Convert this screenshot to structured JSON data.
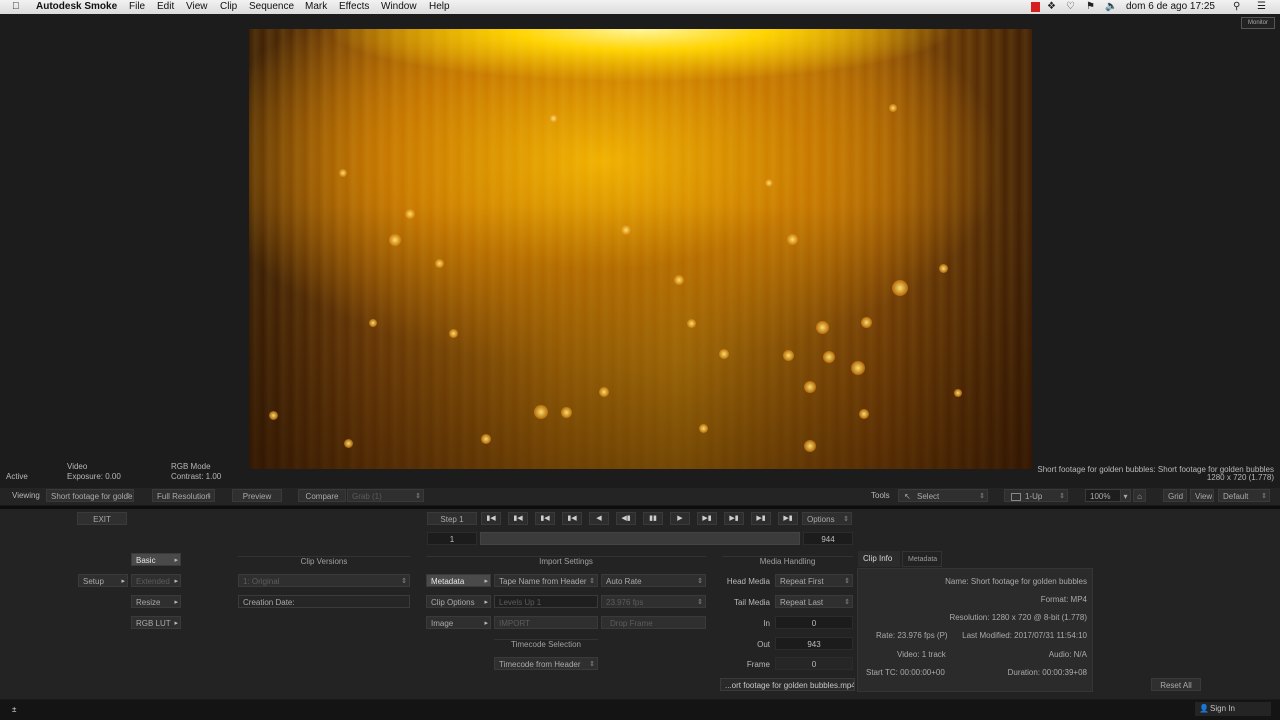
{
  "menubar": {
    "app_name": "Autodesk Smoke",
    "items": [
      "File",
      "Edit",
      "View",
      "Clip",
      "Sequence",
      "Mark",
      "Effects",
      "Window",
      "Help"
    ],
    "datetime": "dom 6 de ago  17:25"
  },
  "viewer": {
    "monitor_button": "Monitor",
    "status": "Active",
    "video_label": "Video",
    "exposure": "Exposure: 0.00",
    "rgb_mode": "RGB Mode",
    "contrast": "Contrast: 1.00",
    "clip_title": "Short footage for golden bubbles: Short footage for golden bubbles",
    "clip_res": "1280 x 720 (1.778)"
  },
  "toolbar": {
    "viewing_label": "Viewing",
    "viewing_value": "Short footage for golde",
    "resolution": "Full Resolution",
    "preview": "Preview",
    "compare": "Compare",
    "grab": "Grab (1)",
    "tools_label": "Tools",
    "select": "Select",
    "layout": "1-Up",
    "zoom": "100%",
    "grid": "Grid",
    "view": "View",
    "default": "Default"
  },
  "panel": {
    "exit": "EXIT",
    "step": "Step 1",
    "options": "Options",
    "frame_start": "1",
    "frame_end": "944",
    "basic": "Basic",
    "extended": "Extended",
    "setup": "Setup",
    "resize": "Resize",
    "rgb_lut": "RGB LUT",
    "clip_versions": {
      "heading": "Clip Versions",
      "version": "1: Original",
      "creation_date": "Creation Date:"
    },
    "import_settings": {
      "heading": "Import Settings",
      "metadata": "Metadata",
      "tape_name": "Tape Name from Header",
      "auto_rate": "Auto Rate",
      "clip_options": "Clip Options",
      "levels": "Levels Up 1",
      "fps": "23.976 fps",
      "image": "Image",
      "import": "IMPORT",
      "drop_frame": "Drop Frame"
    },
    "timecode": {
      "heading": "Timecode Selection",
      "value": "Timecode from Header"
    },
    "media_handling": {
      "heading": "Media Handling",
      "head_label": "Head Media",
      "head_value": "Repeat First",
      "tail_label": "Tail Media",
      "tail_value": "Repeat Last",
      "in_label": "In",
      "in_value": "0",
      "out_label": "Out",
      "out_value": "943",
      "frame_label": "Frame",
      "frame_value": "0",
      "filename": "...ort footage for golden bubbles.mp4"
    },
    "clip_info": {
      "tab_info": "Clip Info",
      "tab_metadata": "Metadata",
      "name": "Name: Short footage for golden bubbles",
      "format": "Format: MP4",
      "resolution": "Resolution: 1280 x 720 @ 8-bit (1.778)",
      "rate": "Rate: 23.976 fps (P)",
      "last_modified": "Last Modified: 2017/07/31 11:54:10",
      "video": "Video: 1 track",
      "audio": "Audio: N/A",
      "start_tc": "Start TC: 00:00:00+00",
      "duration": "Duration: 00:00:39+08"
    },
    "reset_all": "Reset All"
  },
  "status": {
    "left_mark": "±",
    "sign_in": "Sign In"
  },
  "colors": {
    "accent": "#f0b000",
    "panel_bg": "#232323"
  }
}
